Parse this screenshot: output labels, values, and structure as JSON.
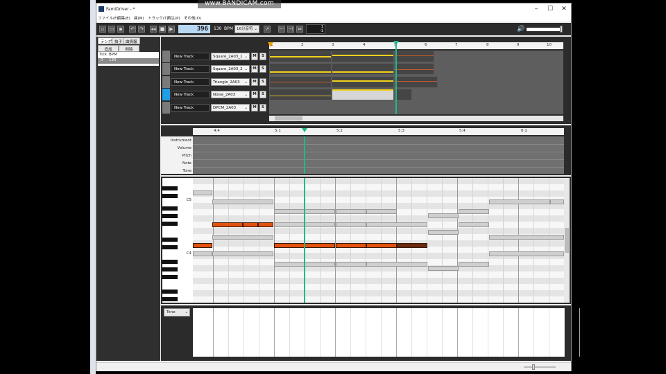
{
  "window": {
    "title": "FamiDriver - *"
  },
  "overlay": {
    "recorder": "www.BANDICAM.com"
  },
  "menu": [
    "ファイル(F)",
    "編集(E)",
    "曲(M)",
    "トラック(T)",
    "再生(P)",
    "その他(O)"
  ],
  "toolbar": {
    "position": "396",
    "bpm_value": "130",
    "bpm_unit": "BPM",
    "note_length": "16分音符",
    "loop_start": "1",
    "loop_end": "-1"
  },
  "sidepanel": {
    "tabs": [
      "テンポ",
      "拍子",
      "曲情報"
    ],
    "buttons": [
      "追加",
      "削除"
    ],
    "table_header": [
      "Tick",
      "BPM"
    ],
    "rows": [
      [
        "0",
        "130"
      ]
    ]
  },
  "tracks": [
    {
      "name": "New Track",
      "instrument": "Square_2A03_1",
      "mute": "M",
      "solo": "S",
      "color": "#7a7a7a"
    },
    {
      "name": "New Track",
      "instrument": "Square_2A03_2",
      "mute": "M",
      "solo": "S",
      "color": "#7a7a7a"
    },
    {
      "name": "New Track",
      "instrument": "Triangle_2A03",
      "mute": "M",
      "solo": "S",
      "color": "#7a7a7a"
    },
    {
      "name": "New Track",
      "instrument": "Noise_2A03",
      "mute": "M",
      "solo": "S",
      "color": "#1f9de6"
    },
    {
      "name": "New Track",
      "instrument": "DPCM_2A03",
      "mute": "M",
      "solo": "S",
      "color": "#7a7a7a"
    }
  ],
  "timeline_measures": [
    "1",
    "2",
    "3",
    "4",
    "5",
    "6",
    "7",
    "8",
    "9",
    "10"
  ],
  "editor": {
    "ruler": [
      "4:4",
      "5:1",
      "5:2",
      "5:3",
      "5:4",
      "6:1"
    ],
    "envelopes": [
      "Instrument",
      "Volume",
      "Pitch",
      "Note",
      "Tone"
    ],
    "piano_labels": [
      "C5",
      "C4"
    ],
    "bottom_param": "Tone"
  },
  "colors": {
    "accent": "#1fb98e",
    "note_active": "#e2520e",
    "note_dark": "#6a2a10",
    "selected_track": "#1f9de6"
  }
}
